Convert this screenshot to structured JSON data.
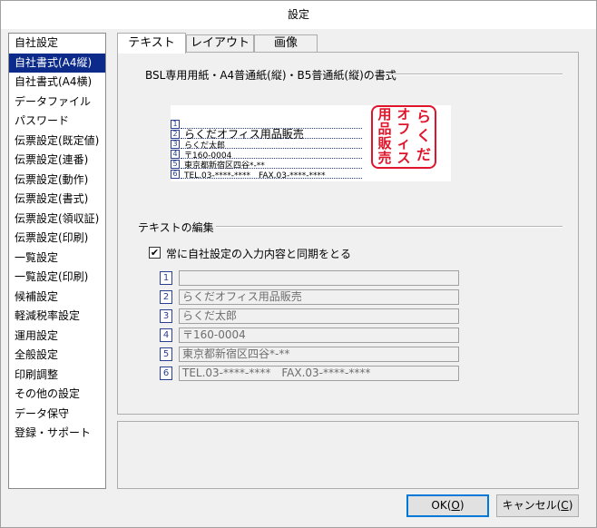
{
  "window": {
    "title": "設定"
  },
  "sidebar": {
    "items": [
      {
        "label": "自社設定",
        "selected": false
      },
      {
        "label": "自社書式(A4縦)",
        "selected": true
      },
      {
        "label": "自社書式(A4横)",
        "selected": false
      },
      {
        "label": "データファイル",
        "selected": false
      },
      {
        "label": "パスワード",
        "selected": false
      },
      {
        "label": "伝票設定(既定値)",
        "selected": false
      },
      {
        "label": "伝票設定(連番)",
        "selected": false
      },
      {
        "label": "伝票設定(動作)",
        "selected": false
      },
      {
        "label": "伝票設定(書式)",
        "selected": false
      },
      {
        "label": "伝票設定(領収証)",
        "selected": false
      },
      {
        "label": "伝票設定(印刷)",
        "selected": false
      },
      {
        "label": "一覧設定",
        "selected": false
      },
      {
        "label": "一覧設定(印刷)",
        "selected": false
      },
      {
        "label": "候補設定",
        "selected": false
      },
      {
        "label": "軽減税率設定",
        "selected": false
      },
      {
        "label": "運用設定",
        "selected": false
      },
      {
        "label": "全般設定",
        "selected": false
      },
      {
        "label": "印刷調整",
        "selected": false
      },
      {
        "label": "その他の設定",
        "selected": false
      },
      {
        "label": "データ保守",
        "selected": false
      },
      {
        "label": "登録・サポート",
        "selected": false
      }
    ]
  },
  "tabs": [
    {
      "label": "テキスト",
      "active": true
    },
    {
      "label": "レイアウト",
      "active": false
    },
    {
      "label": "画像",
      "active": false
    }
  ],
  "format_section": {
    "title": "BSL専用用紙・A4普通紙(縦)・B5普通紙(縦)の書式",
    "preview_lines": [
      {
        "num": "1",
        "text": ""
      },
      {
        "num": "2",
        "text": "らくだオフィス用品販売"
      },
      {
        "num": "3",
        "text": "らくだ太郎"
      },
      {
        "num": "4",
        "text": "〒160-0004"
      },
      {
        "num": "5",
        "text": "東京都新宿区四谷*-**"
      },
      {
        "num": "6",
        "text": "TEL.03-****-****　FAX.03-****-****"
      }
    ],
    "stamp_columns": [
      "らくだ",
      "オフィス",
      "用品販売"
    ]
  },
  "edit_section": {
    "title": "テキストの編集",
    "sync_checkbox": {
      "label": "常に自社設定の入力内容と同期をとる",
      "checked": true,
      "mark": "✔"
    },
    "fields": [
      {
        "num": "1",
        "value": ""
      },
      {
        "num": "2",
        "value": "らくだオフィス用品販売"
      },
      {
        "num": "3",
        "value": "らくだ太郎"
      },
      {
        "num": "4",
        "value": "〒160-0004"
      },
      {
        "num": "5",
        "value": "東京都新宿区四谷*-**"
      },
      {
        "num": "6",
        "value": "TEL.03-****-****　FAX.03-****-****"
      }
    ]
  },
  "buttons": {
    "ok_label": "OK(",
    "ok_key": "O",
    "ok_suffix": ")",
    "cancel_label": "キャンセル(",
    "cancel_key": "C",
    "cancel_suffix": ")"
  },
  "colors": {
    "selection": "#0b2a8a",
    "stamp_red": "#e0142a",
    "line_number_blue": "#2a3f8f"
  }
}
